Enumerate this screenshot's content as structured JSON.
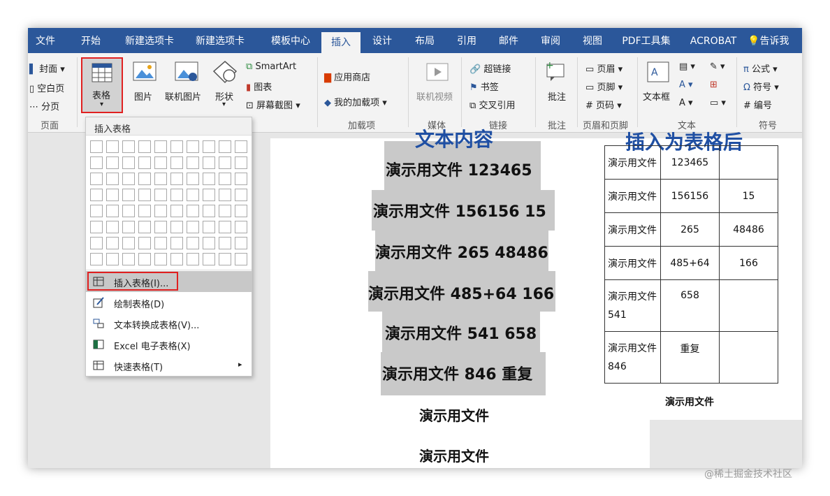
{
  "tabs": [
    {
      "label": "文件",
      "active": false
    },
    {
      "label": "开始",
      "active": false
    },
    {
      "label": "新建选项卡",
      "active": false
    },
    {
      "label": "新建选项卡",
      "active": false
    },
    {
      "label": "模板中心",
      "active": false
    },
    {
      "label": "插入",
      "active": true
    },
    {
      "label": "设计",
      "active": false
    },
    {
      "label": "布局",
      "active": false
    },
    {
      "label": "引用",
      "active": false
    },
    {
      "label": "邮件",
      "active": false
    },
    {
      "label": "审阅",
      "active": false
    },
    {
      "label": "视图",
      "active": false
    },
    {
      "label": "PDF工具集",
      "active": false
    },
    {
      "label": "ACROBAT",
      "active": false
    },
    {
      "label": "告诉我",
      "active": false
    }
  ],
  "ribbon": {
    "pages": {
      "cover": "封面",
      "blank": "空白页",
      "break": "分页",
      "group": "页面"
    },
    "table": {
      "label": "表格"
    },
    "illustrations": {
      "picture": "图片",
      "online_picture": "联机图片",
      "shapes": "形状",
      "smartart": "SmartArt",
      "chart": "图表",
      "screenshot": "屏幕截图"
    },
    "addins": {
      "store": "应用商店",
      "my_addins": "我的加载项",
      "group": "加载项"
    },
    "media": {
      "online_video": "联机视频",
      "group": "媒体"
    },
    "links": {
      "hyperlink": "超链接",
      "bookmark": "书签",
      "crossref": "交叉引用",
      "group": "链接"
    },
    "comments": {
      "comment": "批注",
      "group": "批注"
    },
    "header_footer": {
      "header": "页眉",
      "footer": "页脚",
      "page_number": "页码",
      "group": "页眉和页脚"
    },
    "text": {
      "textbox": "文本框",
      "group": "文本"
    },
    "symbols": {
      "equation": "公式",
      "symbol": "符号",
      "numbering": "编号",
      "group": "符号"
    }
  },
  "dropdown": {
    "header": "插入表格",
    "items": [
      {
        "label": "插入表格(I)...",
        "highlighted": true
      },
      {
        "label": "绘制表格(D)",
        "highlighted": false
      },
      {
        "label": "文本转换成表格(V)...",
        "highlighted": false
      },
      {
        "label": "Excel 电子表格(X)",
        "highlighted": false
      },
      {
        "label": "快速表格(T)",
        "highlighted": false
      }
    ]
  },
  "document": {
    "left_title": "文本内容",
    "right_title": "插入为表格后",
    "lines": [
      "演示用文件  123465",
      "演示用文件  156156 15",
      "演示用文件 265 48486",
      "演示用文件  485+64 166",
      "演示用文件 541 658",
      "演示用文件 846  重复"
    ],
    "plain_lines": [
      "演示用文件",
      "演示用文件"
    ],
    "table_rows": [
      [
        "演示用文件",
        "123465",
        ""
      ],
      [
        "演示用文件",
        "156156",
        "15"
      ],
      [
        "演示用文件",
        "265",
        "48486"
      ],
      [
        "演示用文件",
        "485+64",
        "166"
      ],
      [
        "演示用文件\n541",
        "658",
        ""
      ],
      [
        "演示用文件\n846",
        "重复",
        ""
      ]
    ],
    "after_table": "演示用文件"
  },
  "watermark": "@稀土掘金技术社区"
}
